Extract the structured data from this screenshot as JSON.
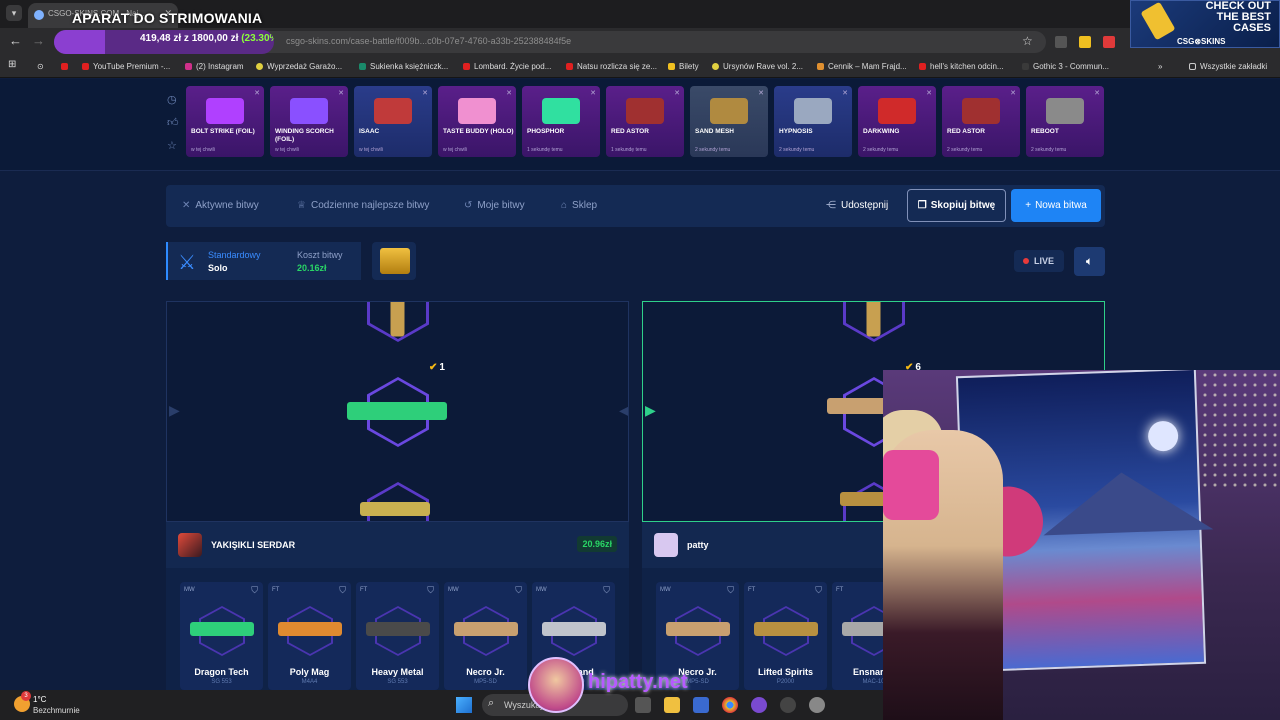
{
  "browser": {
    "tab_title": "CSGO-SKINS.COM - Naj...",
    "overlay_title": "APARAT DO STRIMOWANIA",
    "url": "csgo-skins.com/case-battle/f009b...c0b-07e7-4760-a33b-252388484f5e",
    "goal": {
      "text": "419,48 zł z 1800,00 zł",
      "percent": "(23.30%)",
      "progress": 0.233
    },
    "bookmarks": [
      "YouTube Premium -...",
      "(2) Instagram",
      "Wyprzedaż Garażo...",
      "Sukienka księżniczk...",
      "Lombard. Życie pod...",
      "Natsu rozlicza się ze...",
      "Bilety",
      "Ursynów Rave vol. 2...",
      "Cennik – Mam Frajd...",
      "hell's kitchen odcin...",
      "Gothic 3 - Commun...",
      "Wszystkie zakładki"
    ],
    "promo": {
      "title": "CHECK OUT THE BEST CASES",
      "logo": "CSG⊗SKINS"
    }
  },
  "drops": [
    {
      "name": "BOLT STRIKE (FOIL)",
      "sub": "w tej chwili",
      "color": "#b040ff"
    },
    {
      "name": "WINDING SCORCH (FOIL)",
      "sub": "w tej chwili",
      "color": "#8a50ff"
    },
    {
      "name": "ISAAC",
      "sub": "w tej chwili",
      "color": "#c03a3a"
    },
    {
      "name": "TASTE BUDDY (HOLO)",
      "sub": "w tej chwili",
      "color": "#f090d0"
    },
    {
      "name": "PHOSPHOR",
      "sub": "1 sekundę temu",
      "color": "#30e0a0"
    },
    {
      "name": "RED ASTOR",
      "sub": "1 sekundę temu",
      "color": "#a03030"
    },
    {
      "name": "SAND MESH",
      "sub": "2 sekundy temu",
      "color": "#b08a40"
    },
    {
      "name": "HYPNOSIS",
      "sub": "2 sekundy temu",
      "color": "#9aa8c0"
    },
    {
      "name": "DARKWING",
      "sub": "2 sekundy temu",
      "color": "#d02a2a"
    },
    {
      "name": "RED ASTOR",
      "sub": "2 sekundy temu",
      "color": "#a03030"
    },
    {
      "name": "REBOOT",
      "sub": "2 sekundy temu",
      "color": "#8a8a8a"
    }
  ],
  "nav": {
    "active_battles": "Aktywne bitwy",
    "daily_best": "Codzienne najlepsze bitwy",
    "my_battles": "Moje bitwy",
    "shop": "Sklep",
    "share": "Udostępnij",
    "copy": "Skopiuj bitwę",
    "new": "Nowa bitwa"
  },
  "battle": {
    "mode": "Standardowy",
    "type": "Solo",
    "cost_label": "Koszt bitwy",
    "cost_value": "20.16zł",
    "live": "LIVE"
  },
  "players": [
    {
      "name": "YAKIŞIKLI SERDAR",
      "total": "20.96zł",
      "round_count": "1",
      "items": [
        {
          "wear": "MW",
          "name": "Dragon Tech",
          "type": "SG 553",
          "color": "#2ecf7a"
        },
        {
          "wear": "FT",
          "name": "Poly Mag",
          "type": "M4A4",
          "color": "#e08a30"
        },
        {
          "wear": "FT",
          "name": "Heavy Metal",
          "type": "SG 553",
          "color": "#4a4a4a"
        },
        {
          "wear": "MW",
          "name": "Necro Jr.",
          "type": "MP5-SD",
          "color": "#c8a070"
        },
        {
          "wear": "MW",
          "name": "Freehand",
          "type": "MAC-10",
          "color": "#c0c4cc"
        }
      ]
    },
    {
      "name": "patty",
      "total": "",
      "round_count": "6",
      "items": [
        {
          "wear": "MW",
          "name": "Necro Jr.",
          "type": "MP5-SD",
          "color": "#c8a070"
        },
        {
          "wear": "FT",
          "name": "Lifted Spirits",
          "type": "P2000",
          "color": "#b89040"
        },
        {
          "wear": "FT",
          "name": "Ensnared",
          "type": "MAC-10",
          "color": "#a8a8a8"
        }
      ]
    }
  ],
  "taskbar": {
    "weather_temp": "1°C",
    "weather_desc": "Bezchmurnie",
    "weather_badge": "3",
    "search": "Wyszukaj"
  },
  "stream_watermark": "hipatty.net"
}
